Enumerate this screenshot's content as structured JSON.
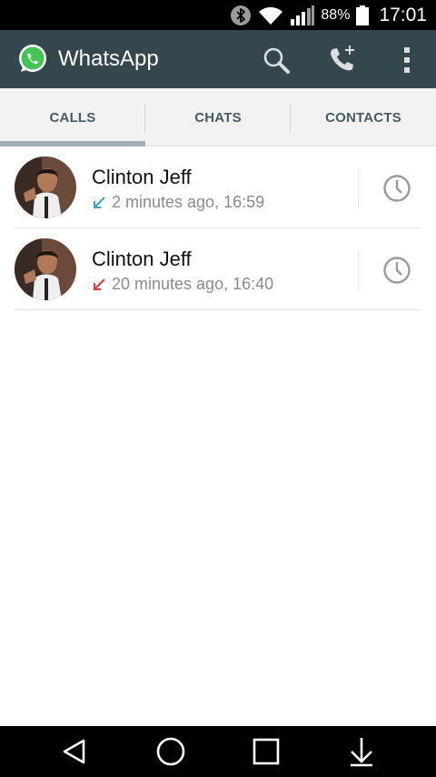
{
  "status_bar": {
    "icons": [
      "bluetooth-icon",
      "wifi-icon",
      "signal-icon",
      "battery-icon"
    ],
    "battery_percent": "88%",
    "time": "17:01"
  },
  "action_bar": {
    "title": "WhatsApp",
    "background_color": "#34474f",
    "actions": [
      "search-icon",
      "new-call-icon",
      "overflow-menu-icon"
    ]
  },
  "tabs": {
    "items": [
      {
        "label": "CALLS",
        "active": true
      },
      {
        "label": "CHATS",
        "active": false
      },
      {
        "label": "CONTACTS",
        "active": false
      }
    ]
  },
  "calls": [
    {
      "name": "Clinton Jeff",
      "direction": "incoming",
      "arrow_color": "#3aa3c8",
      "time": "2 minutes ago, 16:59"
    },
    {
      "name": "Clinton Jeff",
      "direction": "missed",
      "arrow_color": "#e53935",
      "time": "20 minutes ago, 16:40"
    }
  ],
  "nav_bar": {
    "buttons": [
      "back-icon",
      "home-icon",
      "recents-icon",
      "notification-drawer-icon"
    ]
  }
}
